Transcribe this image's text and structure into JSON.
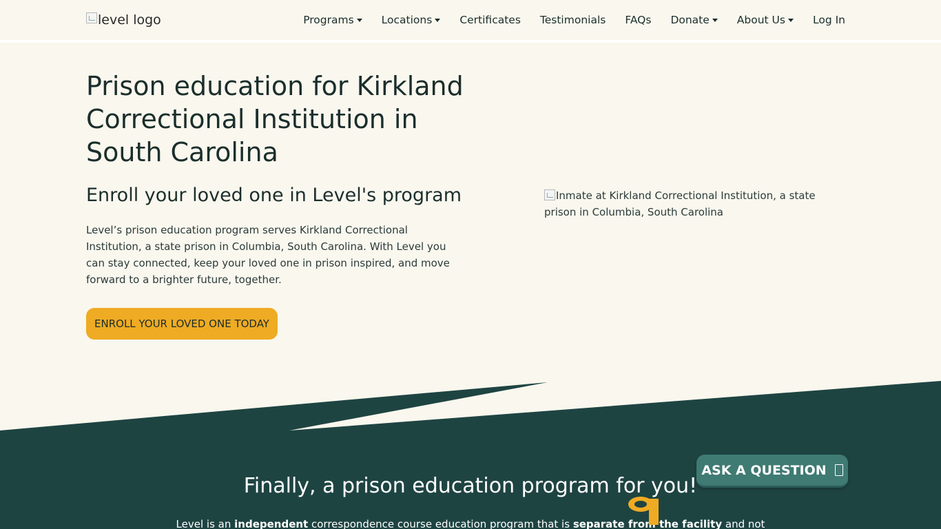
{
  "nav": {
    "logo_alt": "level logo",
    "items": [
      {
        "label": "Programs",
        "dropdown": true
      },
      {
        "label": "Locations",
        "dropdown": true
      },
      {
        "label": "Certificates",
        "dropdown": false
      },
      {
        "label": "Testimonials",
        "dropdown": false
      },
      {
        "label": "FAQs",
        "dropdown": false
      },
      {
        "label": "Donate",
        "dropdown": true
      },
      {
        "label": "About Us",
        "dropdown": true
      },
      {
        "label": "Log In",
        "dropdown": false
      }
    ]
  },
  "hero": {
    "title": "Prison education for Kirkland Correctional Institution in South Carolina",
    "subtitle": "Enroll your loved one in Level's program",
    "body": "Level’s prison education program serves Kirkland Correctional Institution, a state prison in Columbia, South Carolina. With Level you can stay connected, keep your loved one in prison inspired, and move forward to a brighter future, together.",
    "cta_label": "ENROLL YOUR LOVED ONE TODAY",
    "image_alt": "Inmate at Kirkland Correctional Institution, a state prison in Columbia, South Carolina"
  },
  "section": {
    "title": "Finally, a prison education program for you!",
    "body_parts": [
      {
        "text": "Level is an ",
        "bold": false
      },
      {
        "text": "independent",
        "bold": true
      },
      {
        "text": " correspondence course education program that is ",
        "bold": false
      },
      {
        "text": "separate from the facility",
        "bold": true
      },
      {
        "text": " and not",
        "bold": false
      }
    ]
  },
  "ask_button": {
    "label": "ASK A QUESTION",
    "icon": "chat-icon"
  },
  "colors": {
    "background": "#f9f7ee",
    "dark_green": "#1e4442",
    "accent_yellow": "#efab23",
    "ask_button": "#3f7a73",
    "text": "#1b2e2c"
  }
}
